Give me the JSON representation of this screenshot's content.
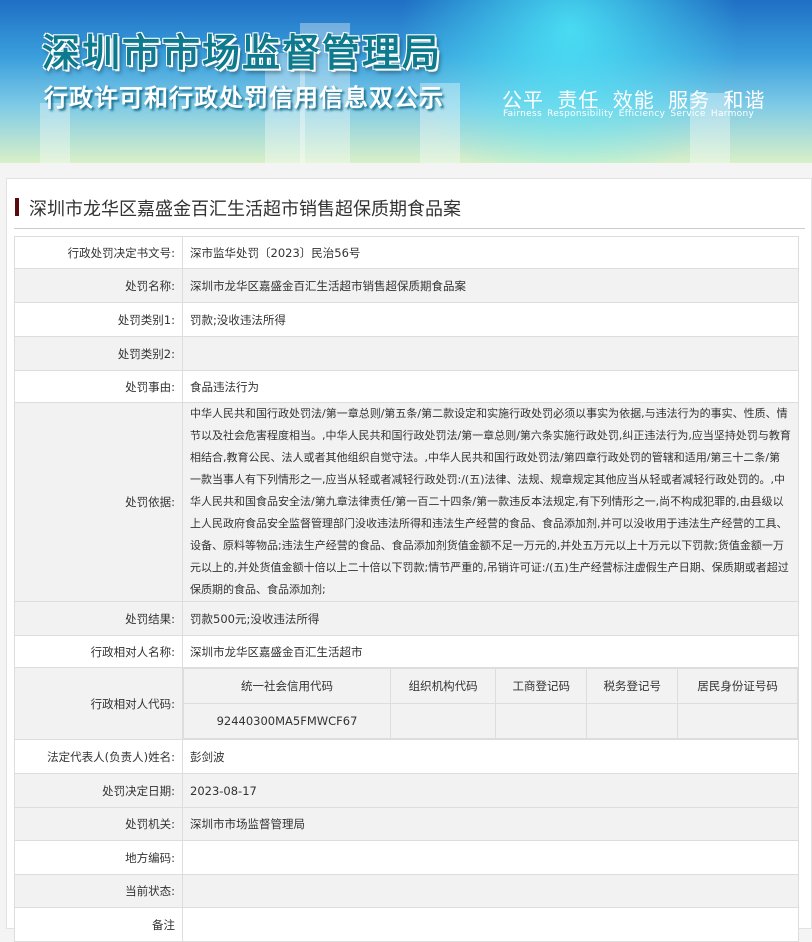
{
  "banner": {
    "title": "深圳市市场监督管理局",
    "subtitle": "行政许可和行政处罚信用信息双公示",
    "slogan": "公平 责任 效能 服务 和谐",
    "slogan_en": "Fairness Responsibility Efficiency Service Harmony"
  },
  "page_title": "深圳市龙华区嘉盛金百汇生活超市销售超保质期食品案",
  "rows": [
    {
      "label": "行政处罚决定书文号:",
      "value": "深市监华处罚〔2023〕民治56号"
    },
    {
      "label": "处罚名称:",
      "value": "深圳市龙华区嘉盛金百汇生活超市销售超保质期食品案"
    },
    {
      "label": "处罚类别1:",
      "value": "罚款;没收违法所得"
    },
    {
      "label": "处罚类别2:",
      "value": ""
    },
    {
      "label": "处罚事由:",
      "value": "食品违法行为"
    },
    {
      "label": "处罚依据:",
      "value": "中华人民共和国行政处罚法/第一章总则/第五条/第二款设定和实施行政处罚必须以事实为依据,与违法行为的事实、性质、情节以及社会危害程度相当。,中华人民共和国行政处罚法/第一章总则/第六条实施行政处罚,纠正违法行为,应当坚持处罚与教育相结合,教育公民、法人或者其他组织自觉守法。,中华人民共和国行政处罚法/第四章行政处罚的管辖和适用/第三十二条/第一款当事人有下列情形之一,应当从轻或者减轻行政处罚:/(五)法律、法规、规章规定其他应当从轻或者减轻行政处罚的。,中华人民共和国食品安全法/第九章法律责任/第一百二十四条/第一款违反本法规定,有下列情形之一,尚不构成犯罪的,由县级以上人民政府食品安全监督管理部门没收违法所得和违法生产经营的食品、食品添加剂,并可以没收用于违法生产经营的工具、设备、原料等物品;违法生产经营的食品、食品添加剂货值金额不足一万元的,并处五万元以上十万元以下罚款;货值金额一万元以上的,并处货值金额十倍以上二十倍以下罚款;情节严重的,吊销许可证:/(五)生产经营标注虚假生产日期、保质期或者超过保质期的食品、食品添加剂;"
    },
    {
      "label": "处罚结果:",
      "value": "罚款500元;没收违法所得"
    },
    {
      "label": "行政相对人名称:",
      "value": "深圳市龙华区嘉盛金百汇生活超市"
    },
    {
      "label": "行政相对人代码:",
      "value": ""
    },
    {
      "label": "法定代表人(负责人)姓名:",
      "value": "彭剑波"
    },
    {
      "label": "处罚决定日期:",
      "value": "2023-08-17"
    },
    {
      "label": "处罚机关:",
      "value": "深圳市市场监督管理局"
    },
    {
      "label": "地方编码:",
      "value": ""
    },
    {
      "label": "当前状态:",
      "value": ""
    },
    {
      "label": "备注",
      "value": ""
    }
  ],
  "codes": {
    "headers": [
      "统一社会信用代码",
      "组织机构代码",
      "工商登记码",
      "税务登记号",
      "居民身份证号码"
    ],
    "values": [
      "92440300MA5FMWCF67",
      "",
      "",
      "",
      ""
    ]
  }
}
